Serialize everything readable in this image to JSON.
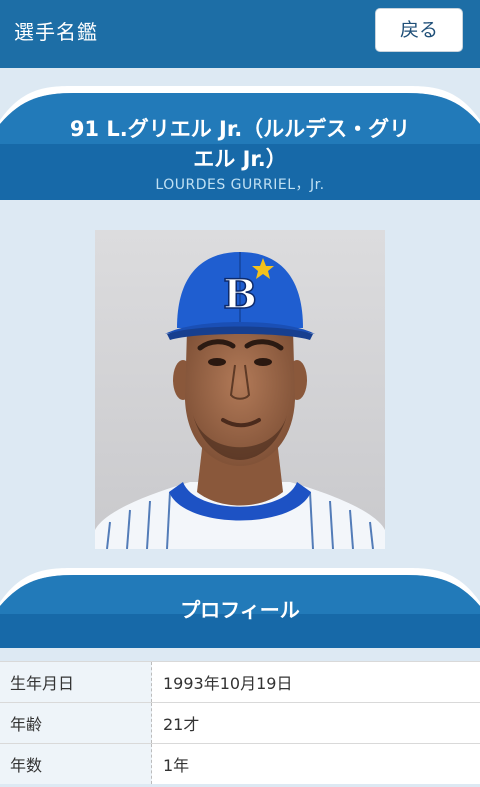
{
  "header": {
    "title": "選手名鑑",
    "back_label": "戻る"
  },
  "player": {
    "name_line1": "91 L.グリエル Jr.（ルルデス・グリ",
    "name_line2": "エル Jr.）",
    "roman_name": "LOURDES GURRIEL，Jr.",
    "cap_letter": "B"
  },
  "profile": {
    "heading": "プロフィール",
    "rows": [
      {
        "label": "生年月日",
        "value": "1993年10月19日"
      },
      {
        "label": "年齢",
        "value": "21才"
      },
      {
        "label": "年数",
        "value": "1年"
      }
    ]
  },
  "colors": {
    "header_bg": "#1d6ea6",
    "banner_blue": "#1769a8",
    "page_bg": "#dde9f3"
  }
}
